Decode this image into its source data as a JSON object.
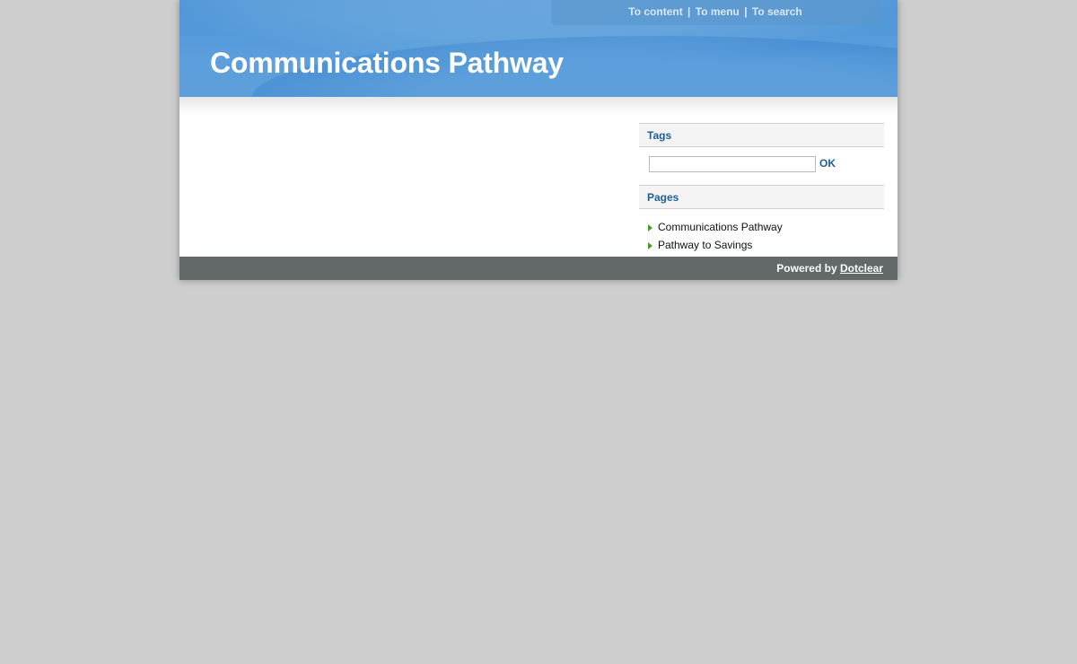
{
  "header": {
    "title": "Communications Pathway",
    "prelude": {
      "to_content": "To content",
      "to_menu": "To menu",
      "to_search": "To search",
      "separator": "|"
    }
  },
  "sidebar": {
    "tags": {
      "title": "Tags",
      "input_value": "",
      "ok_label": "OK"
    },
    "pages": {
      "title": "Pages",
      "items": [
        {
          "label": "Communications Pathway"
        },
        {
          "label": "Pathway to Savings"
        }
      ]
    }
  },
  "footer": {
    "powered_by": "Powered by",
    "link_label": "Dotclear"
  },
  "colors": {
    "page_background": "#cecece",
    "header_blue": "#5b9fdc",
    "widget_title": "#1f5f95",
    "list_arrow": "#4a9a2c",
    "footer": "#636869"
  },
  "icons": {
    "list_bullet": "arrow-right-icon"
  }
}
